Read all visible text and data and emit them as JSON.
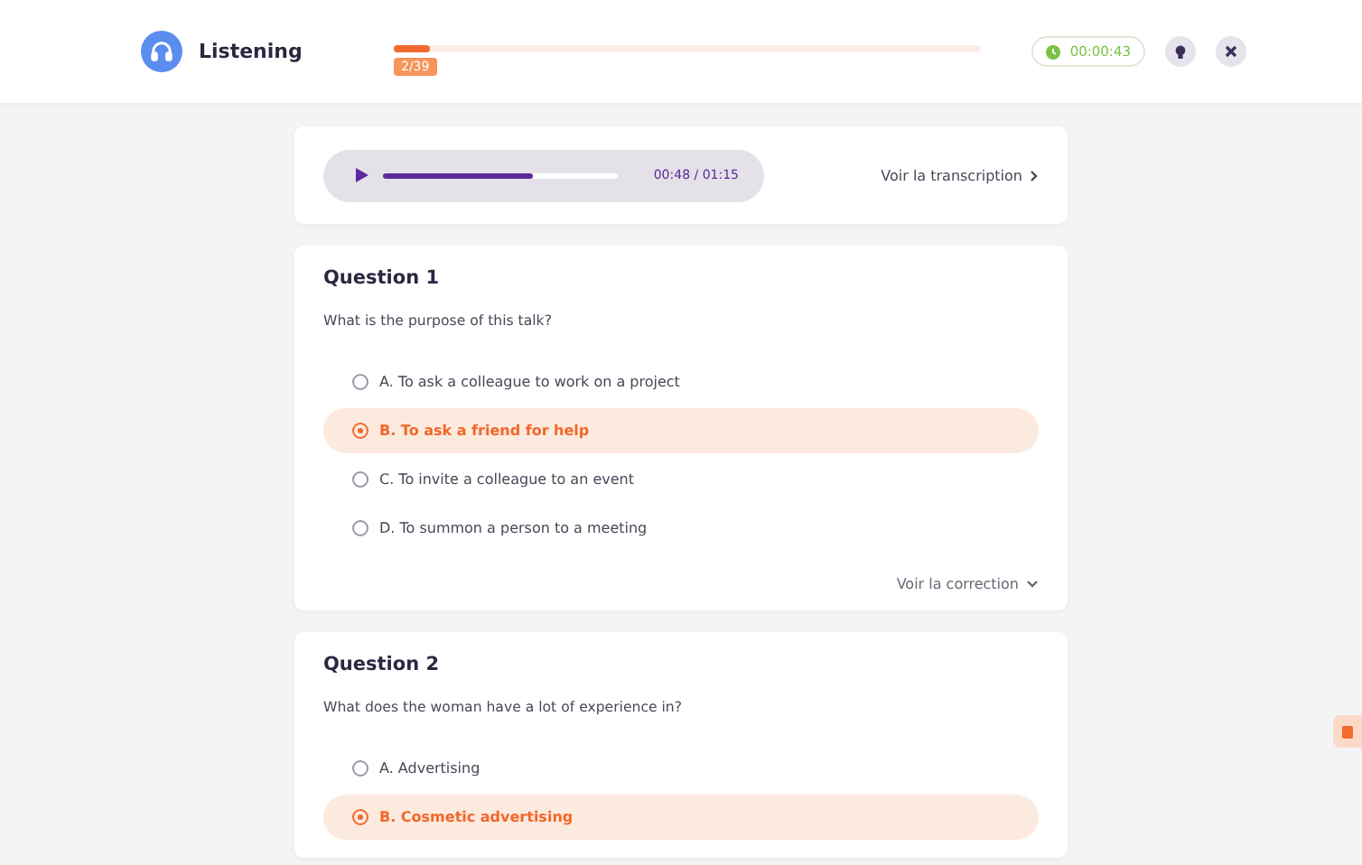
{
  "header": {
    "title": "Listening",
    "progress": {
      "level": 0.06,
      "label": "2/39"
    },
    "timer": "00:00:43"
  },
  "audio": {
    "playing": false,
    "level": 0.64,
    "time": "00:48 / 01:15",
    "transcript_link": "Voir la transcription"
  },
  "questions": [
    {
      "title": "Question 1",
      "prompt": "What is the purpose of this talk?",
      "options": [
        {
          "label": "A. To ask a colleague to work on a project",
          "selected": false
        },
        {
          "label": "B. To ask a friend for help",
          "selected": true
        },
        {
          "label": "C. To invite a colleague to an event",
          "selected": false
        },
        {
          "label": "D. To summon a person to a meeting",
          "selected": false
        }
      ],
      "correction_link": "Voir la correction"
    },
    {
      "title": "Question 2",
      "prompt": "What does the woman have a lot of experience in?",
      "options": [
        {
          "label": "A. Advertising",
          "selected": false
        },
        {
          "label": "B. Cosmetic advertising",
          "selected": true
        }
      ]
    }
  ]
}
